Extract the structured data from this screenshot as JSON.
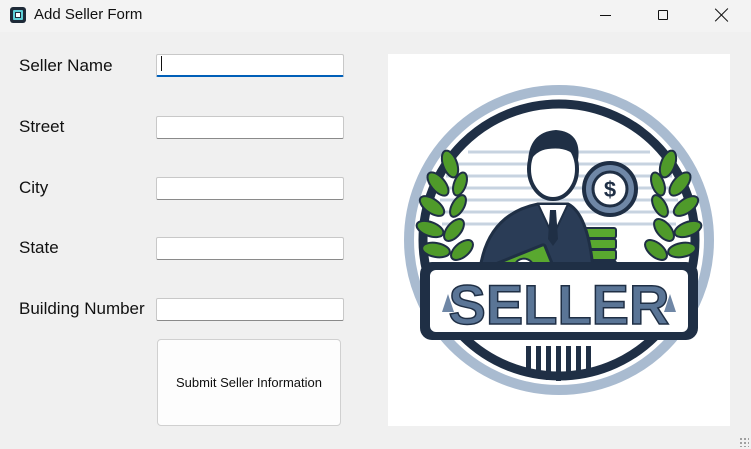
{
  "window": {
    "title": "Add Seller Form",
    "icon": "app-icon",
    "controls": [
      "minimize-icon",
      "maximize-icon",
      "close-icon"
    ]
  },
  "form": {
    "fields": [
      {
        "label": "Seller Name",
        "value": "",
        "focused": true
      },
      {
        "label": "Street",
        "value": ""
      },
      {
        "label": "City",
        "value": ""
      },
      {
        "label": "State",
        "value": ""
      },
      {
        "label": "Building Number",
        "value": ""
      }
    ],
    "submit_label": "Submit Seller Information"
  },
  "logo": {
    "text": "SELLER",
    "colors": {
      "navy": "#1f2f45",
      "slate": "#6f87a6",
      "green": "#59a82f",
      "light": "#d7e1ec"
    }
  },
  "theme": {
    "accent": "#005fb8",
    "background": "#f0f0f0"
  }
}
